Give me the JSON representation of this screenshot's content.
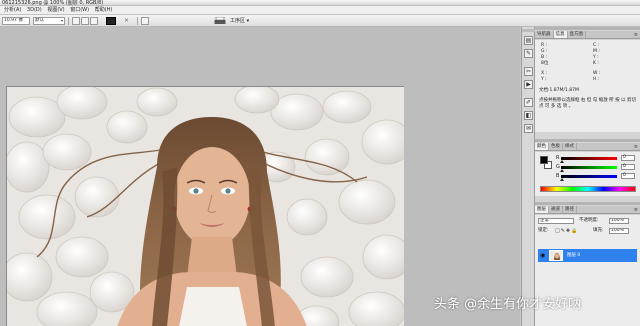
{
  "window": {
    "title": "061215326.png @ 100% (图层 0, RGB/8)"
  },
  "menubar": {
    "items": [
      "分析(A)",
      "3D(D)",
      "视图(V)",
      "窗口(W)",
      "帮助(H)"
    ]
  },
  "optionsbar": {
    "feather": "10.97 像",
    "style": "默认",
    "workspace": "工序区 ▾",
    "icons": [
      "style-button",
      "mode-button",
      "color-swatch",
      "print-icon"
    ]
  },
  "dock": {
    "icons": [
      "histogram-icon",
      "info-icon",
      "tools-icon",
      "actions-icon",
      "brush-icon",
      "history-icon",
      "notes-icon"
    ]
  },
  "panel_info": {
    "tabs": [
      "导航器",
      "信息",
      "直方图"
    ],
    "active_tab": 1,
    "rows": [
      {
        "label": "R :",
        "col": 0
      },
      {
        "label": "C :",
        "col": 1
      },
      {
        "label": "G :",
        "col": 0
      },
      {
        "label": "M :",
        "col": 1
      },
      {
        "label": "B :",
        "col": 0
      },
      {
        "label": "Y :",
        "col": 1
      },
      {
        "label": "8位",
        "col": 0
      },
      {
        "label": "K :",
        "col": 1
      }
    ],
    "xy": [
      "X :",
      "Y :"
    ],
    "wh": [
      "W :",
      "H :"
    ],
    "doc": "文档:1.87M/1.87M",
    "hint": "点按并拖移以选择框 右 但 勾 缩放 所 按 以 剪切点 可 多 选 项 。"
  },
  "panel_color": {
    "tabs": [
      "颜色",
      "色板",
      "样式"
    ],
    "channels": [
      {
        "label": "R",
        "value": "0",
        "color": "#d62020"
      },
      {
        "label": "G",
        "value": "0",
        "color": "#20b030"
      },
      {
        "label": "B",
        "value": "0",
        "color": "#2040d0"
      }
    ]
  },
  "panel_layers": {
    "tabs": [
      "图层",
      "通道",
      "路径"
    ],
    "blend_mode": "正常",
    "opacity_label": "不透明度:",
    "opacity": "100%",
    "lock_label": "锁定:",
    "fill_label": "填充:",
    "fill": "100%",
    "layer_name": "图层 0"
  },
  "watermark": "头条 @余生有你才安好呐",
  "colors": {
    "accent": "#2f82ee",
    "panel": "#ececec",
    "workspace": "#bdbdbd"
  }
}
